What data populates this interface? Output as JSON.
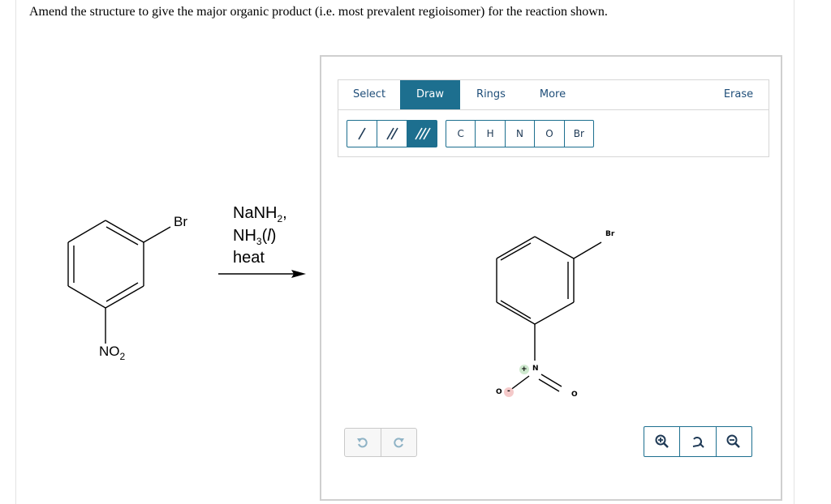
{
  "question": "Amend the structure to give the major organic product (i.e. most prevalent regioisomer) for the reaction shown.",
  "reactant": {
    "substituent_top": "Br",
    "substituent_bottom": {
      "main": "NO",
      "sub": "2"
    }
  },
  "reagents": {
    "line1": {
      "main": "NaNH",
      "sub": "2",
      "tail": ","
    },
    "line2": {
      "main": "NH",
      "sub": "3",
      "tail_open": "(",
      "italic": "l",
      "tail_close": ")"
    },
    "line3": "heat"
  },
  "editor": {
    "tabs": [
      {
        "label": "Select",
        "active": false
      },
      {
        "label": "Draw",
        "active": true
      },
      {
        "label": "Rings",
        "active": false
      },
      {
        "label": "More",
        "active": false
      },
      {
        "label": "Erase",
        "active": false
      }
    ],
    "bonds": [
      "single-bond-icon",
      "double-bond-icon",
      "triple-bond-icon"
    ],
    "atoms": [
      "C",
      "H",
      "N",
      "O",
      "Br"
    ],
    "canvas_labels": {
      "br": "Br",
      "n": "N",
      "plus": "+",
      "o_left": "O",
      "minus": "-",
      "o_right": "O"
    },
    "accent_color": "#1d6f8f",
    "icons": [
      "undo-icon",
      "redo-icon",
      "zoom-in-icon",
      "zoom-reset-icon",
      "zoom-out-icon"
    ]
  }
}
